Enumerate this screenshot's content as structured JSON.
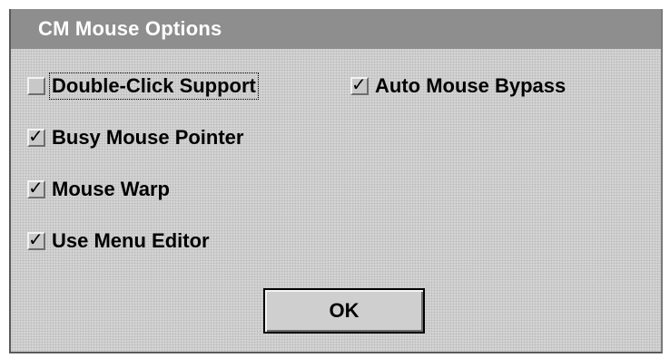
{
  "window": {
    "title": "CM Mouse Options"
  },
  "options": {
    "double_click_support": {
      "label": "Double-Click Support",
      "checked": false
    },
    "auto_mouse_bypass": {
      "label": "Auto Mouse Bypass",
      "checked": true
    },
    "busy_mouse_pointer": {
      "label": "Busy Mouse Pointer",
      "checked": true
    },
    "mouse_warp": {
      "label": "Mouse Warp",
      "checked": true
    },
    "use_menu_editor": {
      "label": "Use Menu Editor",
      "checked": true
    }
  },
  "buttons": {
    "ok_label": "OK"
  },
  "check_glyph": "✓",
  "colors": {
    "title_bar": "#8e8e8e",
    "window_bg": "#d2d2d2",
    "title_text": "#ffffff"
  }
}
